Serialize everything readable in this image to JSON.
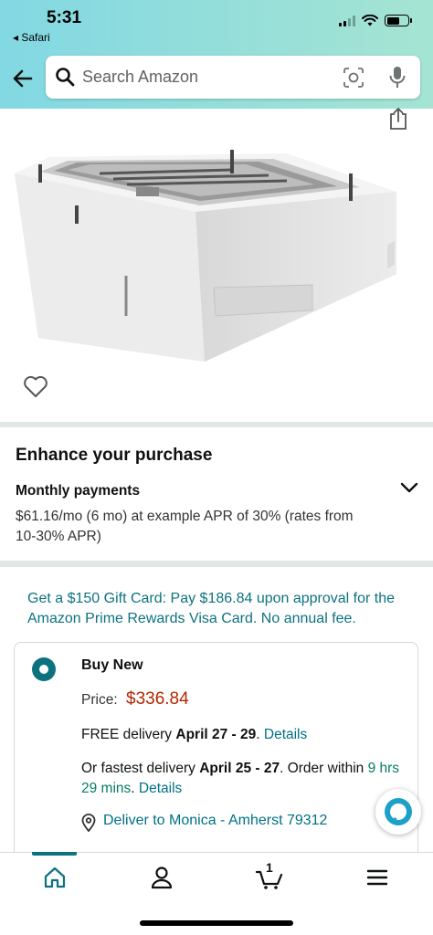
{
  "status_bar": {
    "time": "5:31",
    "back_app": "◂ Safari"
  },
  "search": {
    "placeholder": "Search Amazon"
  },
  "icons": {
    "back": "arrow-left-icon",
    "search": "search-icon",
    "lens": "camera-lens-icon",
    "mic": "microphone-icon",
    "share": "share-icon",
    "wishlist": "heart-icon",
    "expand": "chevron-down-icon",
    "location": "location-pin-icon",
    "alexa": "alexa-icon",
    "nav_home": "home-icon",
    "nav_account": "person-icon",
    "nav_cart": "cart-icon",
    "nav_menu": "menu-icon"
  },
  "enhance": {
    "title": "Enhance your purchase",
    "monthly_title": "Monthly payments",
    "monthly_desc": "$61.16/mo (6 mo) at example APR of 30% (rates from 10-30% APR)"
  },
  "promo": {
    "text": "Get a $150 Gift Card: Pay $186.84 upon approval for the Amazon Prime Rewards Visa Card. No annual fee."
  },
  "buy_box": {
    "option_label": "Buy New",
    "price_label": "Price:",
    "price_value": "$336.84",
    "free_delivery_prefix": "FREE delivery ",
    "free_delivery_dates": "April 27 - 29",
    "free_delivery_sep": ". ",
    "details_link": "Details",
    "fastest_prefix": "Or fastest delivery ",
    "fastest_dates": "April 25 - 27",
    "fastest_mid": ". Order within ",
    "fastest_time": "9 hrs 29 mins",
    "fastest_sep": ". ",
    "deliver_to": "Deliver to Monica - Amherst 79312"
  },
  "bottom_nav": {
    "cart_count": "1"
  },
  "colors": {
    "header_gradient_start": "#82d8e3",
    "header_gradient_end": "#a5e4d2",
    "link": "#007185",
    "price": "#b12704",
    "accent": "#0d7280",
    "green": "#067d62"
  }
}
